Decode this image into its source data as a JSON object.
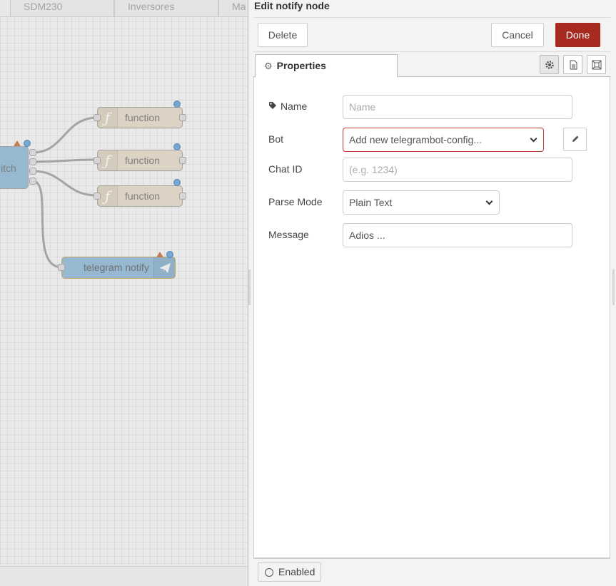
{
  "workspace": {
    "flow_tabs": [
      "SDM230",
      "Inversores",
      "Ma"
    ],
    "nodes": {
      "switch_label": "itch",
      "function_labels": [
        "function",
        "function",
        "function"
      ],
      "telegram_label": "telegram notify"
    }
  },
  "editor": {
    "title": "Edit notify node",
    "delete_label": "Delete",
    "cancel_label": "Cancel",
    "done_label": "Done",
    "tab_properties": "Properties",
    "icons": {
      "settings": "gear-icon",
      "description": "document-icon",
      "appearance": "frame-icon"
    },
    "form": {
      "name": {
        "label": "Name",
        "value": "",
        "placeholder": "Name"
      },
      "bot": {
        "label": "Bot",
        "selected": "Add new telegrambot-config..."
      },
      "chat_id": {
        "label": "Chat ID",
        "value": "",
        "placeholder": "(e.g. 1234)"
      },
      "parse_mode": {
        "label": "Parse Mode",
        "selected": "Plain Text"
      },
      "message": {
        "label": "Message",
        "value": "Adios ..."
      }
    },
    "enabled_label": "Enabled"
  },
  "colors": {
    "done_button": "#a72a20",
    "function_node": "#e4d7c4",
    "telegram_node": "#86b3d4",
    "status_dot": "#5a9ed8",
    "bot_select_border": "#c23b32"
  }
}
